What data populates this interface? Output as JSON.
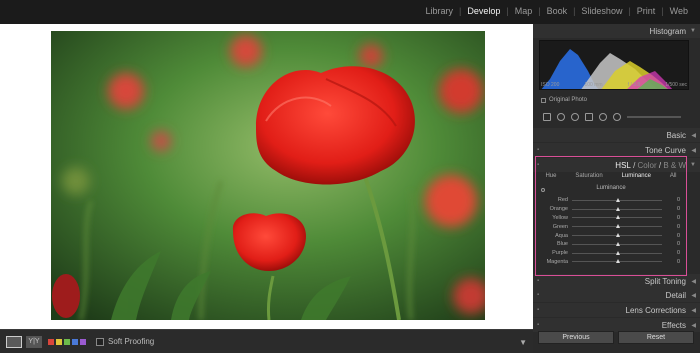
{
  "modules": [
    {
      "label": "Library",
      "active": false
    },
    {
      "label": "Develop",
      "active": true
    },
    {
      "label": "Map",
      "active": false
    },
    {
      "label": "Book",
      "active": false
    },
    {
      "label": "Slideshow",
      "active": false
    },
    {
      "label": "Print",
      "active": false
    },
    {
      "label": "Web",
      "active": false
    }
  ],
  "panel": {
    "histogram": {
      "title": "Histogram",
      "iso": "ISO 200",
      "focal": "100 mm",
      "aperture": "f / 3.8",
      "shutter": "1/500 sec",
      "original_photo": "Original Photo"
    },
    "basic": "Basic",
    "tone_curve": "Tone Curve",
    "hsl": {
      "title_hsl": "HSL",
      "title_color": "Color",
      "title_bw": "B & W",
      "tabs": [
        "Hue",
        "Saturation",
        "Luminance",
        "All"
      ],
      "active_tab": "Luminance",
      "section_label": "Luminance",
      "rows": [
        {
          "label": "Red",
          "value": "0"
        },
        {
          "label": "Orange",
          "value": "0"
        },
        {
          "label": "Yellow",
          "value": "0"
        },
        {
          "label": "Green",
          "value": "0"
        },
        {
          "label": "Aqua",
          "value": "0"
        },
        {
          "label": "Blue",
          "value": "0"
        },
        {
          "label": "Purple",
          "value": "0"
        },
        {
          "label": "Magenta",
          "value": "0"
        }
      ]
    },
    "split_toning": "Split Toning",
    "detail": "Detail",
    "lens_corrections": "Lens Corrections",
    "effects": "Effects",
    "previous": "Previous",
    "reset": "Reset"
  },
  "toolbar": {
    "view_mode_label": "Y|Y",
    "soft_proofing": "Soft Proofing",
    "flag_colors": [
      "#d9453b",
      "#e0c53a",
      "#6dbb4b",
      "#4a79d8",
      "#9b5bd1"
    ]
  },
  "colors": {
    "accent_highlight": "#d94f97"
  }
}
